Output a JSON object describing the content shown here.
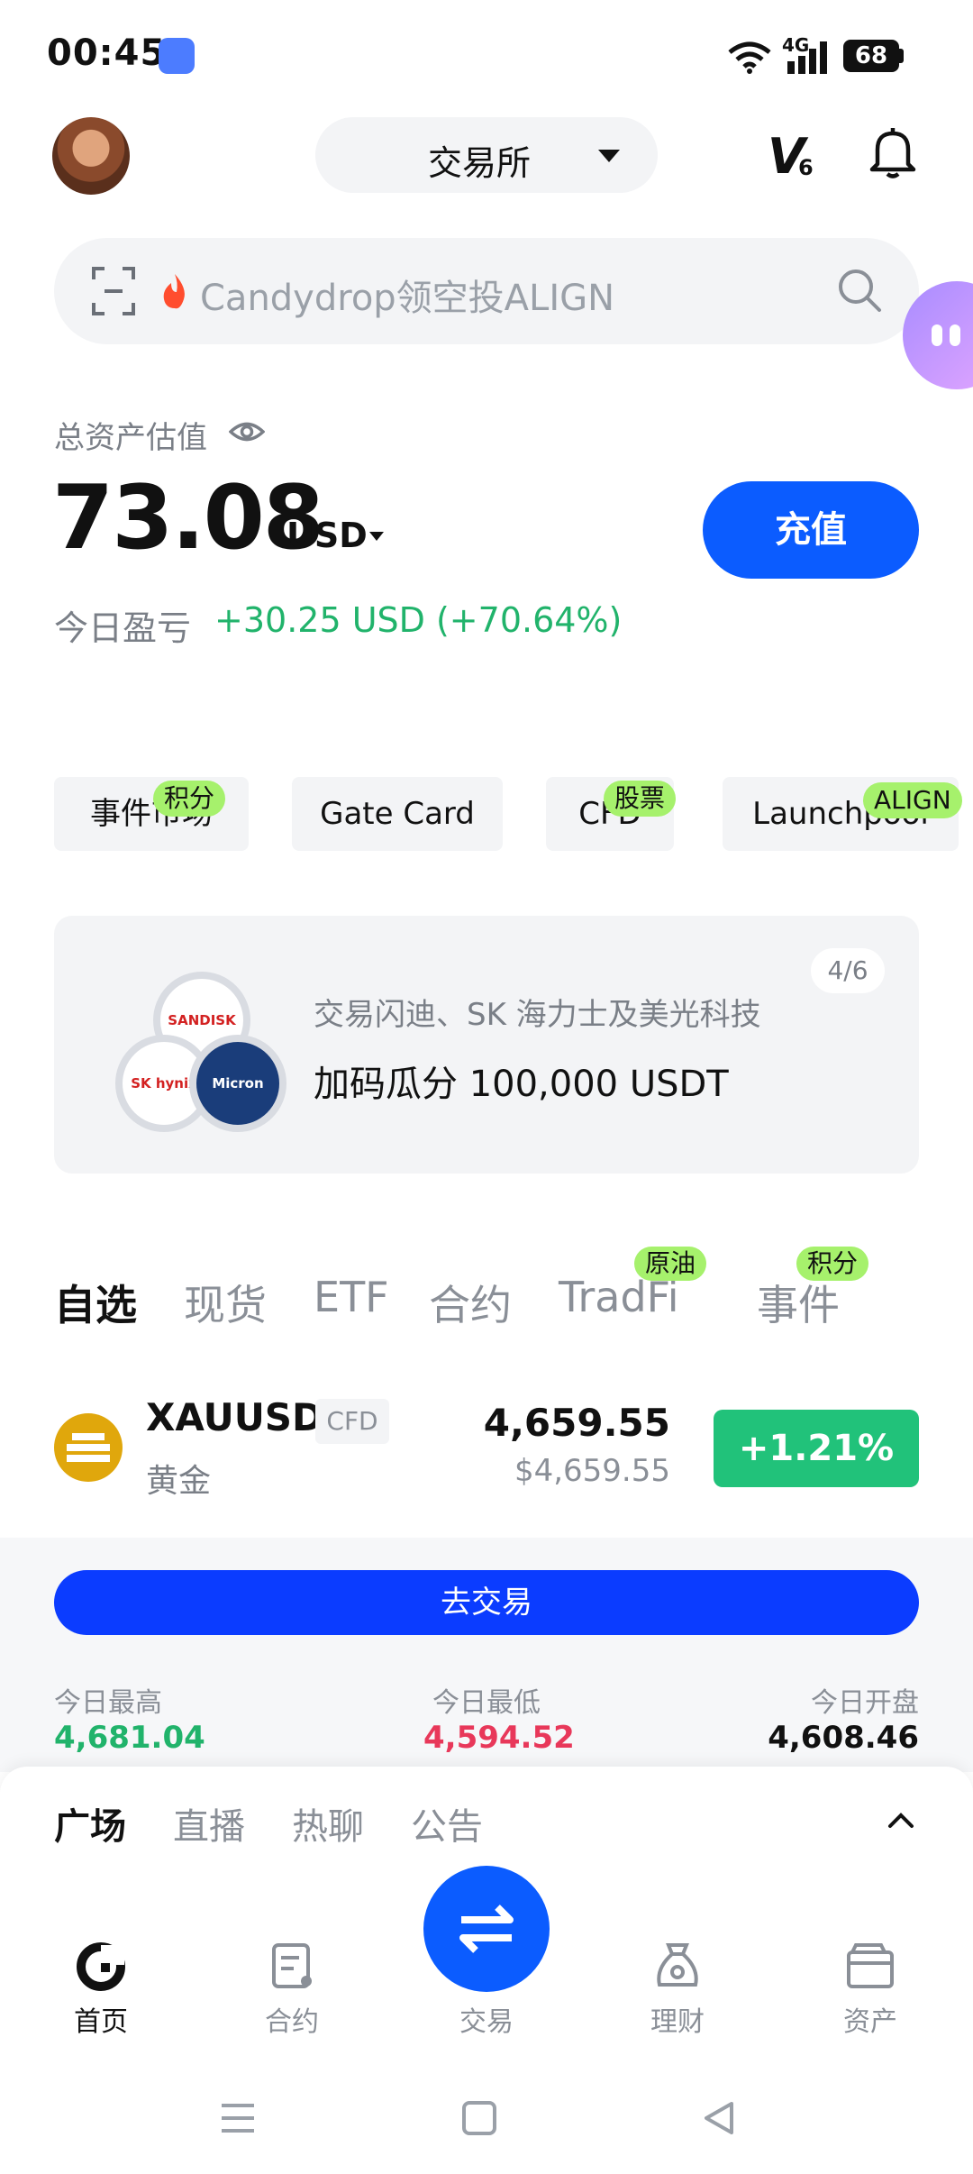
{
  "status_bar": {
    "time": "00:45",
    "network": "4G",
    "battery": "68"
  },
  "header": {
    "exchange_label": "交易所",
    "vip_letter": "V",
    "vip_level": "6"
  },
  "search": {
    "text": "Candydrop领空投ALIGN"
  },
  "assets": {
    "label": "总资产估值",
    "value": "73.08",
    "unit": "USD",
    "deposit_label": "充值",
    "pnl_label": "今日盈亏",
    "pnl_value": "+30.25 USD (+70.64%)"
  },
  "chips": [
    {
      "label": "事件市场",
      "badge": "积分"
    },
    {
      "label": "Gate Card",
      "badge": ""
    },
    {
      "label": "CFD",
      "badge": "股票"
    },
    {
      "label": "Launchpool",
      "badge": "ALIGN"
    }
  ],
  "banner": {
    "page": "4/6",
    "subtitle": "交易闪迪、SK 海力士及美光科技",
    "title": "加码瓜分 100,000 USDT",
    "logos": [
      "SANDISK",
      "SK hynix",
      "Micron"
    ]
  },
  "market_tabs": [
    {
      "label": "自选",
      "badge": ""
    },
    {
      "label": "现货",
      "badge": ""
    },
    {
      "label": "ETF",
      "badge": ""
    },
    {
      "label": "合约",
      "badge": ""
    },
    {
      "label": "TradFi",
      "badge": "原油"
    },
    {
      "label": "事件",
      "badge": "积分"
    }
  ],
  "ticker": {
    "symbol": "XAUUSD",
    "tag": "CFD",
    "name": "黄金",
    "price": "4,659.55",
    "price_usd": "$4,659.55",
    "change": "+1.21%",
    "trade_label": "去交易",
    "stats": [
      {
        "label": "今日最高",
        "value": "4,681.04",
        "color": "#21b36b"
      },
      {
        "label": "今日最低",
        "value": "4,594.52",
        "color": "#e8385a"
      },
      {
        "label": "今日开盘",
        "value": "4,608.46",
        "color": "#111111"
      }
    ]
  },
  "feed_tabs": [
    "广场",
    "直播",
    "热聊",
    "公告"
  ],
  "bottom_nav": [
    {
      "label": "首页",
      "icon": "home-icon"
    },
    {
      "label": "合约",
      "icon": "futures-icon"
    },
    {
      "label": "交易",
      "icon": "swap-icon"
    },
    {
      "label": "理财",
      "icon": "earn-icon"
    },
    {
      "label": "资产",
      "icon": "wallet-icon"
    }
  ],
  "colors": {
    "brand_blue": "#0b5cff",
    "up_green": "#21c27a",
    "down_red": "#e8385a",
    "badge_green": "#a6f16c"
  }
}
